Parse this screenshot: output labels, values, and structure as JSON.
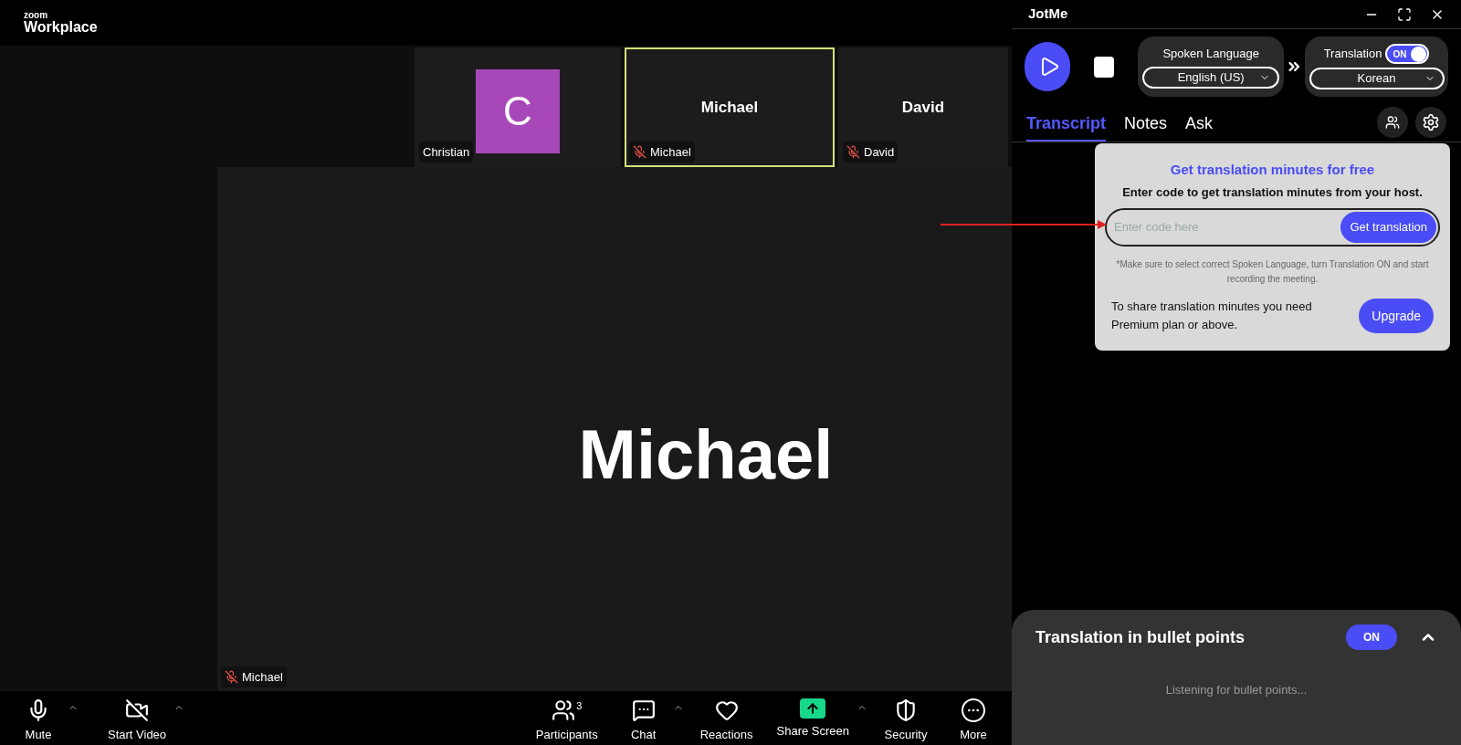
{
  "zoom": {
    "logo_top": "zoom",
    "logo_bottom": "Workplace",
    "thumbnails": [
      {
        "kind": "avatar",
        "initial": "C",
        "tag": "Christian",
        "muted": false,
        "selected": false
      },
      {
        "kind": "name",
        "label": "Michael",
        "tag": "Michael",
        "muted": true,
        "selected": true
      },
      {
        "kind": "name",
        "label": "David",
        "tag": "David",
        "muted": true,
        "selected": false
      }
    ],
    "main_video": {
      "label": "Michael",
      "tag": "Michael",
      "muted": true
    },
    "toolbar_left": [
      {
        "kind": "mic",
        "label": "Mute",
        "caret": true
      },
      {
        "kind": "video-off",
        "label": "Start Video",
        "caret": true
      }
    ],
    "toolbar_right": [
      {
        "kind": "participants",
        "label": "Participants",
        "badge": "3",
        "caret": false
      },
      {
        "kind": "chat",
        "label": "Chat",
        "caret": true
      },
      {
        "kind": "reactions",
        "label": "Reactions",
        "caret": false
      },
      {
        "kind": "share",
        "label": "Share Screen",
        "caret": true
      },
      {
        "kind": "security",
        "label": "Security",
        "caret": false
      },
      {
        "kind": "more",
        "label": "More",
        "caret": false
      }
    ]
  },
  "jotme": {
    "title": "JotMe",
    "spoken_language": {
      "label": "Spoken Language",
      "value": "English (US)"
    },
    "translation": {
      "label": "Translation",
      "toggle": "ON",
      "on": true,
      "value": "Korean"
    },
    "tabs": [
      {
        "label": "Transcript",
        "selected": true
      },
      {
        "label": "Notes",
        "selected": false
      },
      {
        "label": "Ask",
        "selected": false
      }
    ],
    "popup": {
      "title": "Get translation minutes for free",
      "subtitle": "Enter code to get translation minutes from your host.",
      "placeholder": "Enter code here",
      "button": "Get translation",
      "note": "*Make sure to select correct Spoken Language, turn Translation ON and start recording the meeting.",
      "upgrade_text": "To share translation minutes you need Premium plan or above.",
      "upgrade_button": "Upgrade"
    },
    "bullet_panel": {
      "title": "Translation in bullet points",
      "toggle": "ON",
      "on": true,
      "status": "Listening for bullet points..."
    }
  }
}
